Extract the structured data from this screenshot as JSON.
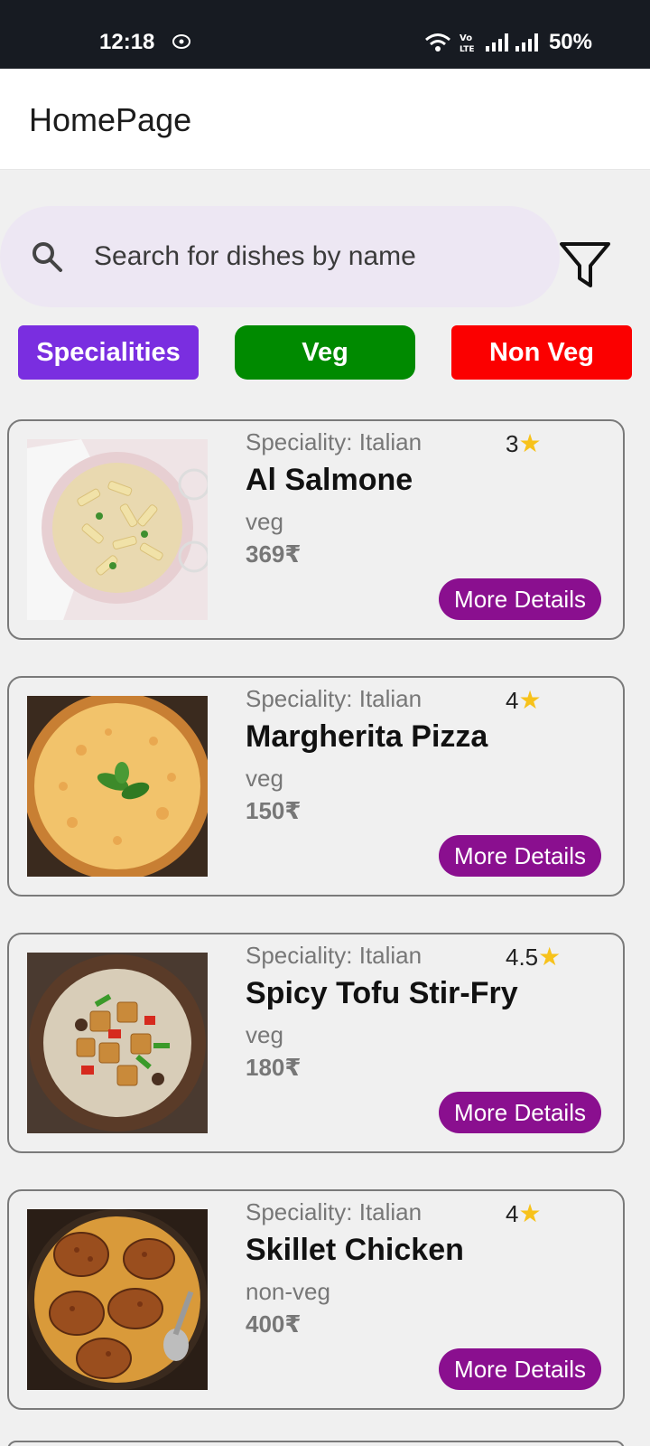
{
  "status_bar": {
    "time": "12:18",
    "battery": "50%",
    "icons": [
      "nfc-icon",
      "wifi-icon",
      "volte-icon",
      "signal-icon",
      "signal-icon"
    ]
  },
  "app_bar": {
    "title": "HomePage"
  },
  "search": {
    "placeholder": "Search for dishes by name",
    "value": "",
    "icon": "search-icon",
    "filter_icon": "filter-icon"
  },
  "chips": [
    {
      "label": "Specialities",
      "color": "#7a2ee0"
    },
    {
      "label": "Veg",
      "color": "#008a00"
    },
    {
      "label": "Non Veg",
      "color": "#fb0000"
    }
  ],
  "dishes": [
    {
      "speciality": "Speciality: Italian",
      "rating": "3",
      "name": "Al Salmone",
      "type": "veg",
      "price": "369₹",
      "button": "More Details"
    },
    {
      "speciality": "Speciality: Italian",
      "rating": "4",
      "name": "Margherita Pizza",
      "type": "veg",
      "price": "150₹",
      "button": "More Details"
    },
    {
      "speciality": "Speciality: Italian",
      "rating": "4.5",
      "name": "Spicy Tofu Stir-Fry",
      "type": "veg",
      "price": "180₹",
      "button": "More Details"
    },
    {
      "speciality": "Speciality: Italian",
      "rating": "4",
      "name": "Skillet Chicken",
      "type": "non-veg",
      "price": "400₹",
      "button": "More Details"
    }
  ],
  "colors": {
    "accent_button": "#8a0f8f",
    "star": "#f7c21b",
    "search_bg": "#ede7f3"
  }
}
